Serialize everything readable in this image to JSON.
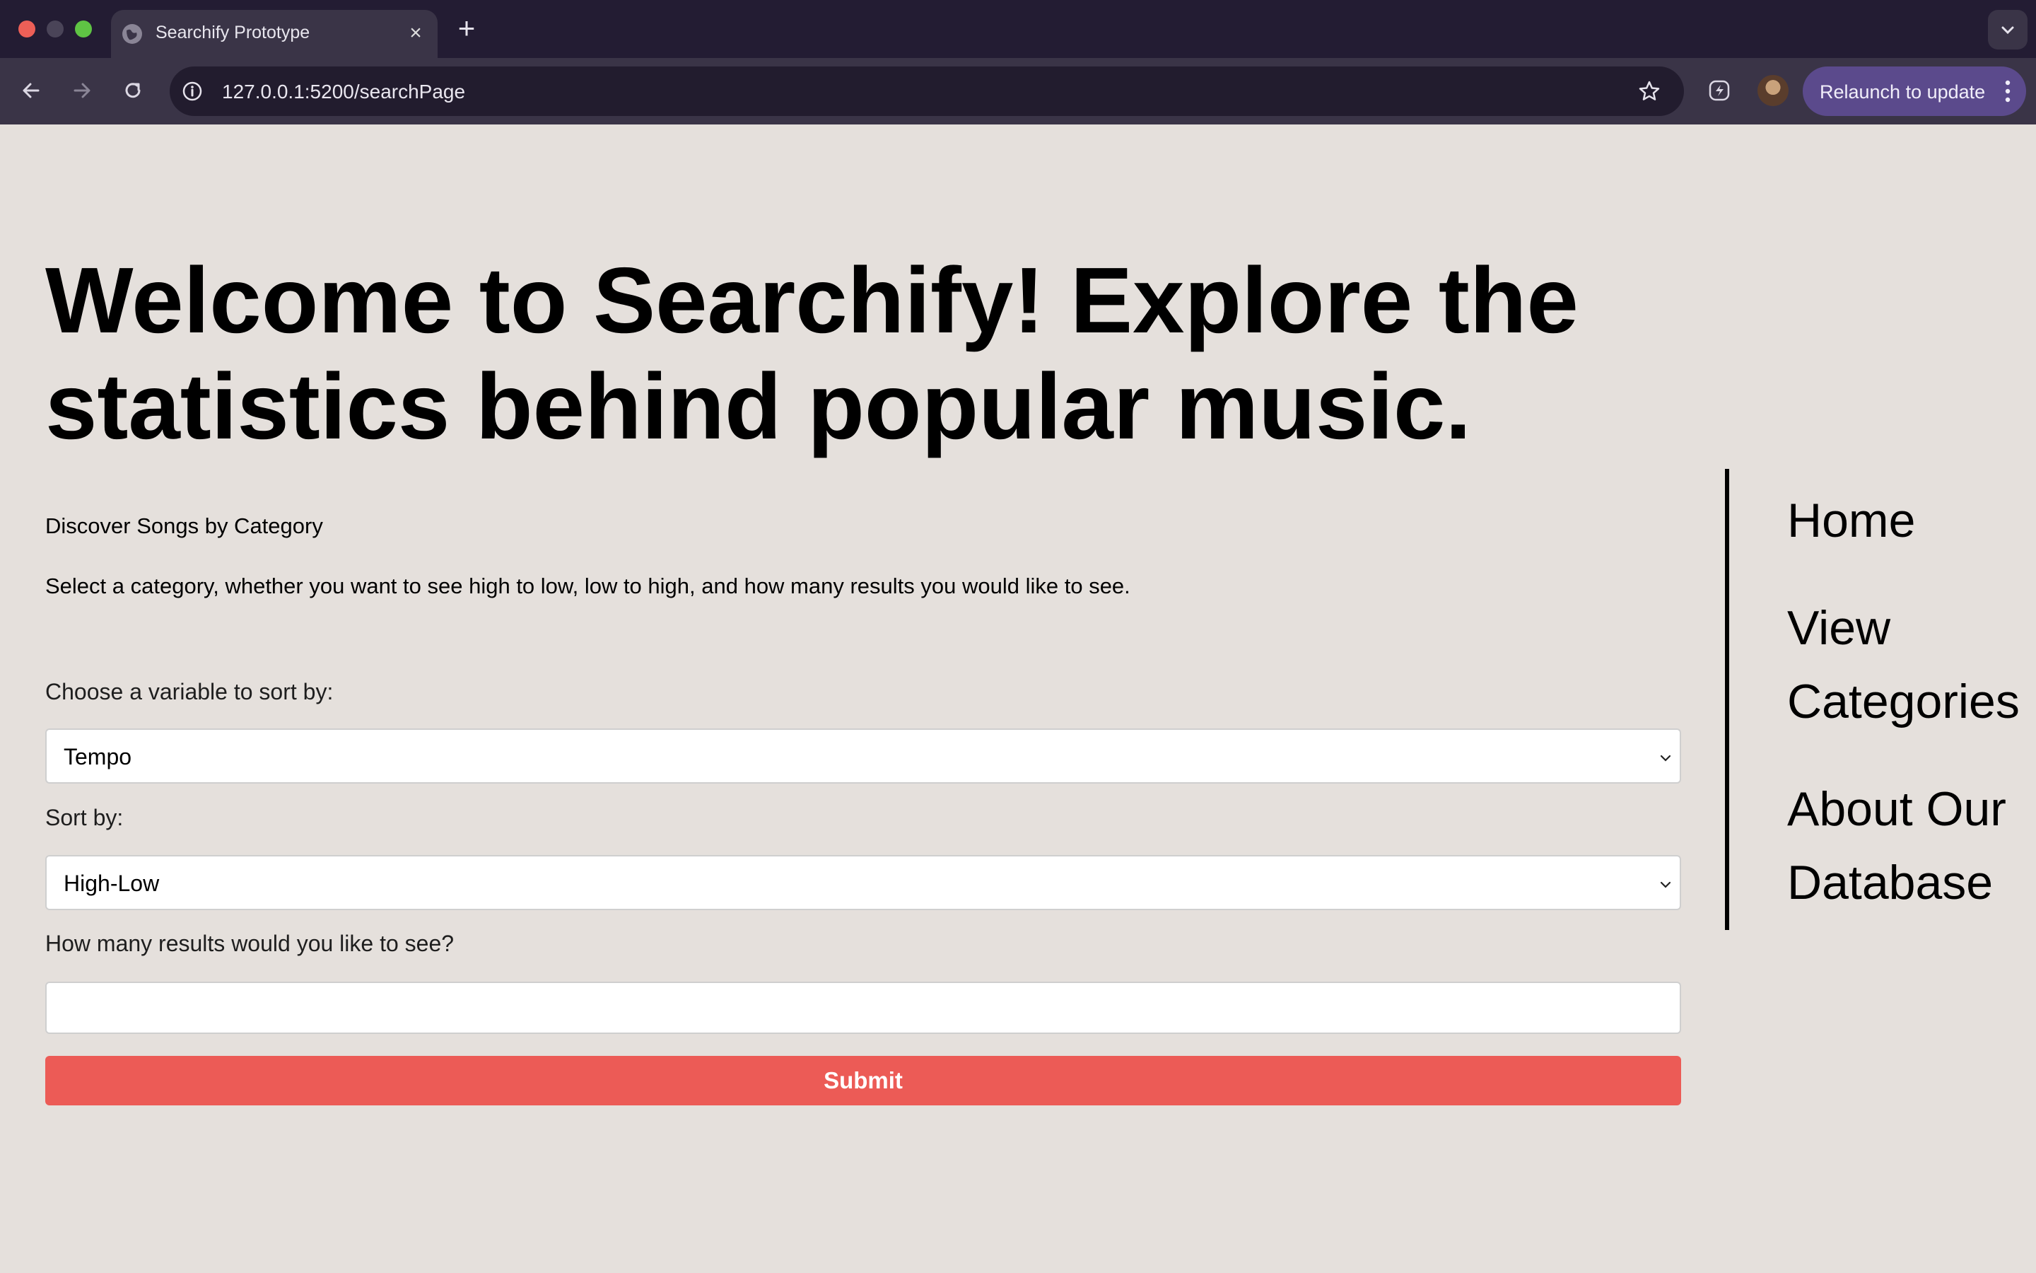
{
  "browser": {
    "tab_title": "Searchify Prototype",
    "url": "127.0.0.1:5200/searchPage",
    "relaunch_label": "Relaunch to update"
  },
  "page": {
    "headline": "Welcome to Searchify! Explore the statistics behind popular music.",
    "discover_title": "Discover Songs by Category",
    "instructions": "Select a category, whether you want to see high to low, low to high, and how many results you would like to see."
  },
  "form": {
    "variable_label": "Choose a variable to sort by:",
    "variable_value": "Tempo",
    "sort_label": "Sort by:",
    "sort_value": "High-Low",
    "count_label": "How many results would you like to see?",
    "count_value": "",
    "submit_label": "Submit"
  },
  "sidebar": {
    "items": [
      {
        "label": "Home"
      },
      {
        "label": "View Categories"
      },
      {
        "label": "About Our Database"
      }
    ]
  },
  "colors": {
    "page_background": "#e5e0dc",
    "submit_button": "#ec5b56",
    "relaunch_button": "#5b4a8c",
    "browser_frame": "#231c33"
  }
}
